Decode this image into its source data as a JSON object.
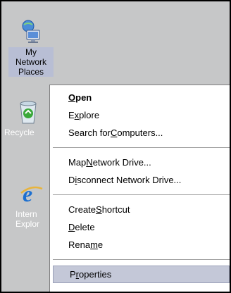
{
  "desktop": {
    "icons": [
      {
        "label": "My Network Places",
        "icon": "network-places-icon",
        "selected": true
      },
      {
        "label": "Recycle Bin",
        "icon": "recycle-bin-icon",
        "visible_label": "Recycle"
      },
      {
        "label": "Internet Explorer",
        "icon": "internet-explorer-icon",
        "visible_label_line1": "Intern",
        "visible_label_line2": "Explor"
      }
    ]
  },
  "context_menu": {
    "items": [
      {
        "label": "Open",
        "access_key": "O",
        "bold": true
      },
      {
        "label": "Explore",
        "access_key": "x"
      },
      {
        "label": "Search for Computers...",
        "access_key": "C"
      },
      {
        "label": "Map Network Drive...",
        "access_key": "N"
      },
      {
        "label": "Disconnect Network Drive...",
        "access_key": "i"
      },
      {
        "label": "Create Shortcut",
        "access_key": "S"
      },
      {
        "label": "Delete",
        "access_key": "D"
      },
      {
        "label": "Rename",
        "access_key": "m"
      },
      {
        "label": "Properties",
        "access_key": "r",
        "highlighted": true
      }
    ]
  },
  "colors": {
    "desktop_bg": "#c6c7c8",
    "menu_bg": "#ffffff",
    "highlight": "#c4c8d8",
    "label_selected_bg": "#b8bed4"
  }
}
